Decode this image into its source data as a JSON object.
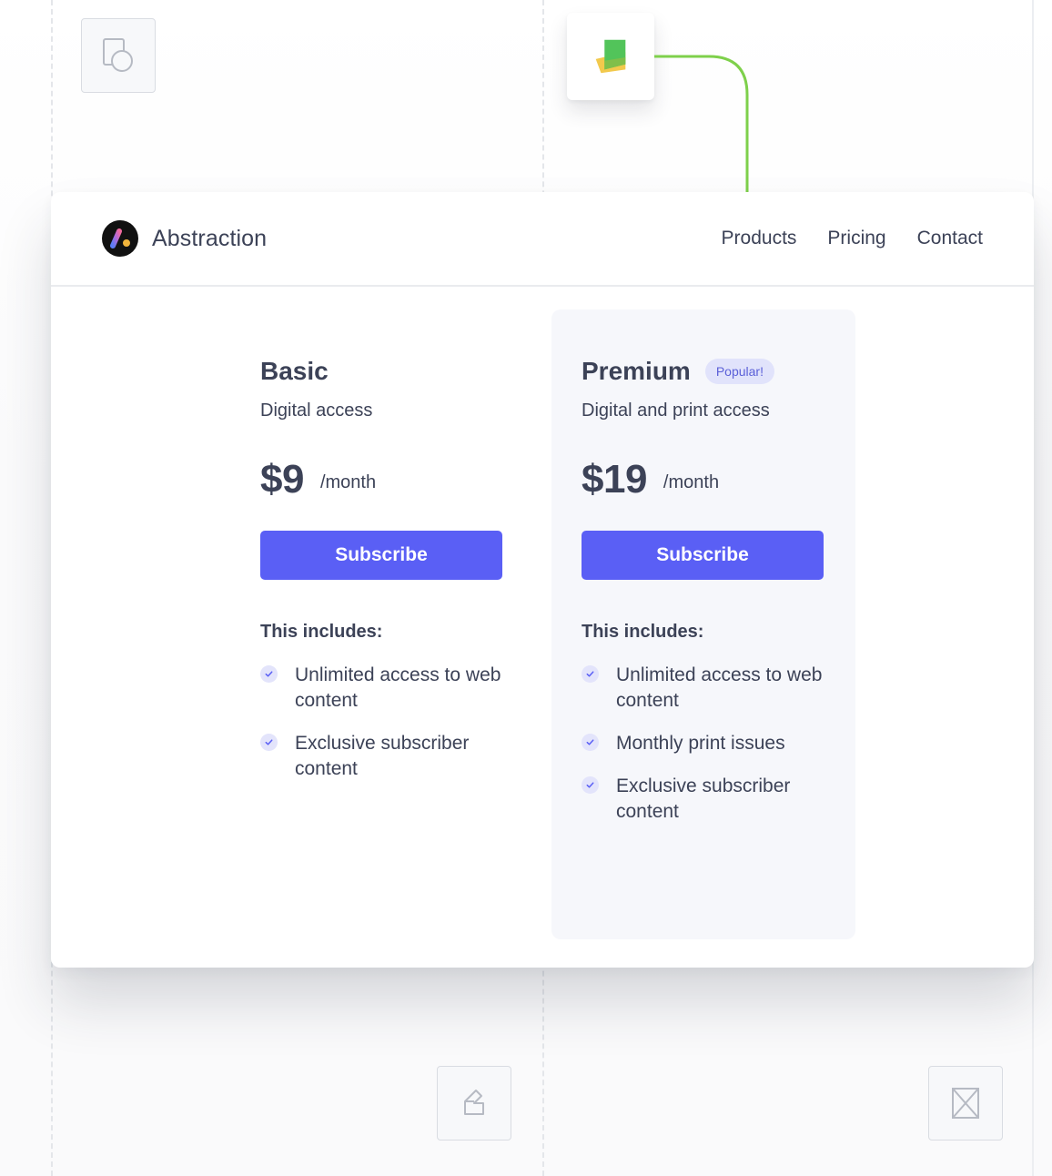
{
  "header": {
    "brand_name": "Abstraction",
    "nav": [
      "Products",
      "Pricing",
      "Contact"
    ]
  },
  "plans": [
    {
      "name": "Basic",
      "description": "Digital access",
      "price": "$9",
      "period": "/month",
      "button_label": "Subscribe",
      "includes_label": "This includes:",
      "features": [
        "Unlimited access to web content",
        "Exclusive subscriber content"
      ]
    },
    {
      "name": "Premium",
      "badge": "Popular!",
      "description": "Digital and print access",
      "price": "$19",
      "period": "/month",
      "button_label": "Subscribe",
      "includes_label": "This includes:",
      "features": [
        "Unlimited access to web content",
        "Monthly print issues",
        "Exclusive subscriber content"
      ]
    }
  ],
  "colors": {
    "accent": "#5a5ff5",
    "badge_bg": "#e1e3fb",
    "connector": "#7ed04b"
  },
  "icons": {
    "top_left_tile": "shapes-icon",
    "float_card": "stacked-cards-icon",
    "bottom_middle_tile": "paper-fold-icon",
    "bottom_right_tile": "hourglass-icon",
    "feature_check": "check-icon"
  }
}
